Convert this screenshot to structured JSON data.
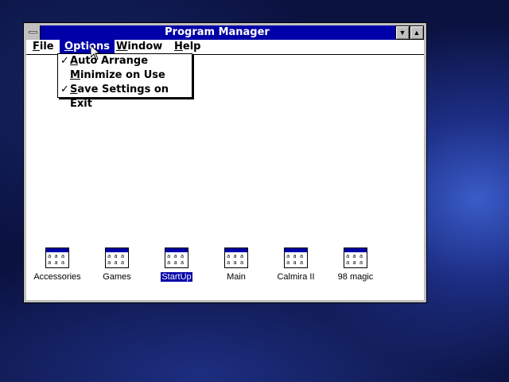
{
  "window": {
    "title": "Program Manager",
    "minimize_glyph": "▼",
    "maximize_glyph": "▲"
  },
  "menubar": {
    "file": {
      "hot": "F",
      "rest": "ile"
    },
    "options": {
      "hot": "O",
      "rest": "ptions"
    },
    "window": {
      "hot": "W",
      "rest": "indow"
    },
    "help": {
      "hot": "H",
      "rest": "elp"
    }
  },
  "options_menu": {
    "items": [
      {
        "check": "✓",
        "hot": "A",
        "rest": "uto Arrange"
      },
      {
        "check": "",
        "hot": "M",
        "rest": "inimize on Use"
      },
      {
        "check": "✓",
        "hot": "S",
        "rest": "ave Settings on Exit"
      }
    ]
  },
  "groups": [
    {
      "label": "Accessories",
      "selected": false
    },
    {
      "label": "Games",
      "selected": false
    },
    {
      "label": "StartUp",
      "selected": true
    },
    {
      "label": "Main",
      "selected": false
    },
    {
      "label": "Calmira II",
      "selected": false
    },
    {
      "label": "98 magic",
      "selected": false
    }
  ],
  "colors": {
    "titlebar": "#0000a8",
    "selection": "#0000a8",
    "desktop": "#0b1240"
  },
  "icons": {
    "system": "system-menu-icon",
    "group": "program-group-icon",
    "pointer": "mouse-pointer-icon"
  }
}
